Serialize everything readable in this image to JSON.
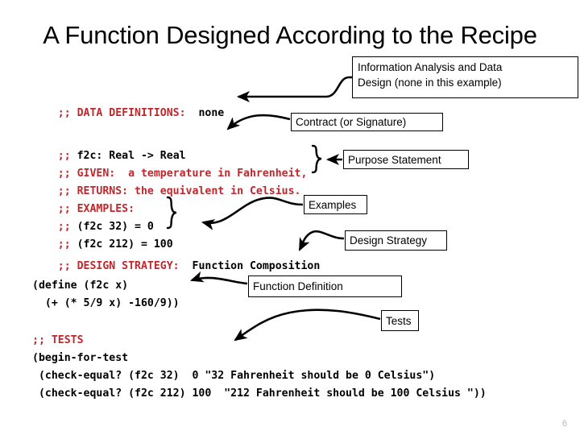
{
  "slide": {
    "title": "A Function Designed According to the Recipe",
    "page_number": "6",
    "accent_comment_color": "#C0272D",
    "text_color": "#000000",
    "background": "#ffffff"
  },
  "code": {
    "lines": [
      {
        "id": "data-definitions",
        "comment": ";; DATA DEFINITIONS:",
        "body": "  none"
      },
      {
        "id": "blank-1",
        "comment": "",
        "body": ""
      },
      {
        "id": "signature",
        "comment": ";;",
        "body": " f2c: Real -> Real"
      },
      {
        "id": "given",
        "comment": ";; GIVEN:  a temperature in Fahrenheit,",
        "body": ""
      },
      {
        "id": "returns",
        "comment": ";; RETURNS: the equivalent in Celsius.",
        "body": ""
      },
      {
        "id": "examples-header",
        "comment": ";; EXAMPLES:",
        "body": ""
      },
      {
        "id": "example-1",
        "comment": ";;",
        "body": " (f2c 32) = 0"
      },
      {
        "id": "example-2",
        "comment": ";;",
        "body": " (f2c 212) = 100"
      },
      {
        "id": "design-strategy",
        "comment": ";; DESIGN STRATEGY:",
        "body": "  Function Composition"
      }
    ],
    "definition": [
      "(define (f2c x)",
      "  (+ (* 5/9 x) -160/9))"
    ],
    "tests_comment": ";; TESTS",
    "tests": [
      "(begin-for-test",
      " (check-equal? (f2c 32)  0 \"32 Fahrenheit should be 0 Celsius\")",
      " (check-equal? (f2c 212) 100  \"212 Fahrenheit should be 100 Celsius \"))"
    ]
  },
  "callouts": {
    "information_analysis": {
      "line1": "Information Analysis and Data",
      "line2": "Design (none in this example)"
    },
    "contract": "Contract (or Signature)",
    "purpose_statement": "Purpose Statement",
    "examples": "Examples",
    "design_strategy": "Design Strategy",
    "function_definition": "Function Definition",
    "tests": "Tests"
  }
}
